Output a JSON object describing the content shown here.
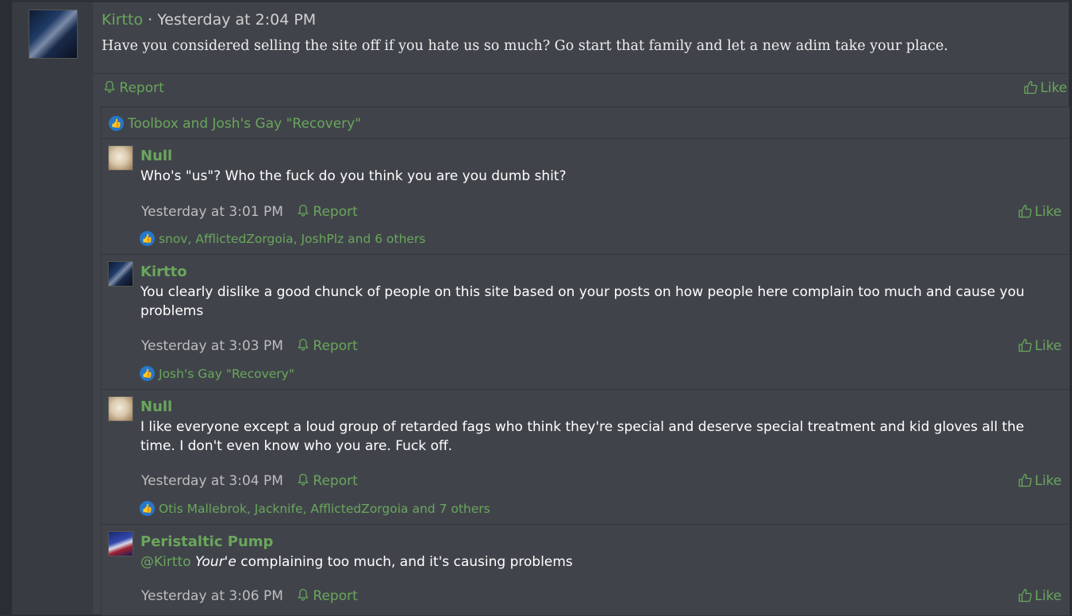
{
  "post": {
    "author": "Kirtto",
    "separator": "·",
    "timestamp": "Yesterday at 2:04 PM",
    "body": "Have you considered selling the site off if you hate us so much? Go start that family and let a new adim take your place.",
    "report_label": "Report",
    "like_label": "Like",
    "likers": "Toolbox and Josh's Gay \"Recovery\""
  },
  "comments": [
    {
      "author": "Null",
      "text": "Who's \"us\"? Who the fuck do you think you are you dumb shit?",
      "timestamp": "Yesterday at 3:01 PM",
      "report_label": "Report",
      "like_label": "Like",
      "likers": "snov, AfflictedZorgoia, JoshPlz and 6 others"
    },
    {
      "author": "Kirtto",
      "text": "You clearly dislike a good chunck of people on this site based on your posts on how people here complain too much and cause you problems",
      "timestamp": "Yesterday at 3:03 PM",
      "report_label": "Report",
      "like_label": "Like",
      "likers": "Josh's Gay \"Recovery\""
    },
    {
      "author": "Null",
      "text": "I like everyone except a loud group of retarded fags who think they're special and deserve special treatment and kid gloves all the time. I don't even know who you are. Fuck off.",
      "timestamp": "Yesterday at 3:04 PM",
      "report_label": "Report",
      "like_label": "Like",
      "likers": "Otis Mallebrok, Jacknife, AfflictedZorgoia and 7 others"
    },
    {
      "author": "Peristaltic Pump",
      "mention": "@Kirtto",
      "text_emphasis": "Your'e",
      "text_rest": " complaining too much, and it's causing problems",
      "timestamp": "Yesterday at 3:06 PM",
      "report_label": "Report",
      "like_label": "Like"
    }
  ],
  "icons": {
    "report": "bell-icon",
    "like": "thumbs-up-icon",
    "like_badge": "thumbs-up-badge-icon"
  },
  "colors": {
    "accent": "#6aa65c",
    "badge": "#2577c9",
    "background": "#40444a"
  }
}
